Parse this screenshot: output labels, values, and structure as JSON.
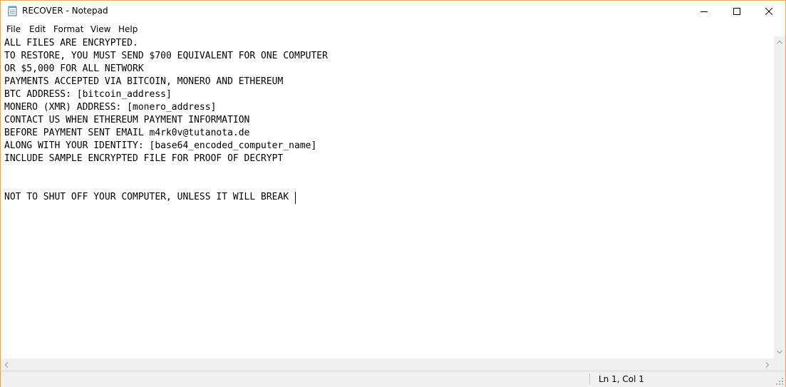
{
  "window": {
    "title": "RECOVER - Notepad",
    "frame_color": "#e8a060",
    "app_icon": "notepad-icon"
  },
  "caption_buttons": {
    "minimize_icon": "minimize-icon",
    "maximize_icon": "maximize-icon",
    "close_icon": "close-icon"
  },
  "menu": {
    "items": [
      "File",
      "Edit",
      "Format",
      "View",
      "Help"
    ]
  },
  "editor": {
    "lines": [
      "ALL FILES ARE ENCRYPTED.",
      "TO RESTORE, YOU MUST SEND $700 EQUIVALENT FOR ONE COMPUTER",
      "OR $5,000 FOR ALL NETWORK",
      "PAYMENTS ACCEPTED VIA BITCOIN, MONERO AND ETHEREUM",
      "BTC ADDRESS: [bitcoin_address]",
      "MONERO (XMR) ADDRESS: [monero_address]",
      "CONTACT US WHEN ETHEREUM PAYMENT INFORMATION",
      "BEFORE PAYMENT SENT EMAIL m4rk0v@tutanota.de",
      "ALONG WITH YOUR IDENTITY: [base64_encoded_computer_name]",
      "INCLUDE SAMPLE ENCRYPTED FILE FOR PROOF OF DECRYPT",
      "",
      "",
      "NOT TO SHUT OFF YOUR COMPUTER, UNLESS IT WILL BREAK"
    ]
  },
  "status": {
    "position": "Ln 1, Col 1"
  }
}
